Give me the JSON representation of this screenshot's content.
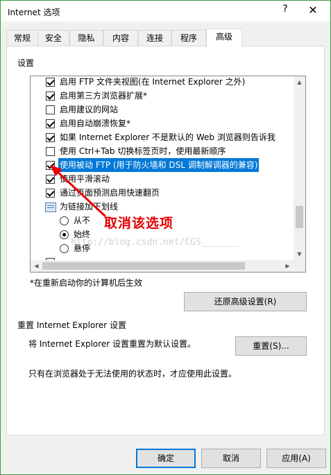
{
  "window": {
    "title": "Internet 选项",
    "help_label": "?",
    "close_label": "✕"
  },
  "tabs": [
    {
      "label": "常规"
    },
    {
      "label": "安全"
    },
    {
      "label": "隐私"
    },
    {
      "label": "内容"
    },
    {
      "label": "连接"
    },
    {
      "label": "程序"
    },
    {
      "label": "高级",
      "active": true
    }
  ],
  "settings": {
    "label": "设置",
    "items": [
      {
        "type": "checkbox",
        "checked": true,
        "label": "启用 FTP 文件夹视图(在 Internet Explorer 之外)"
      },
      {
        "type": "checkbox",
        "checked": true,
        "label": "启用第三方浏览器扩展*"
      },
      {
        "type": "checkbox",
        "checked": false,
        "label": "启用建议的网站"
      },
      {
        "type": "checkbox",
        "checked": true,
        "label": "启用自动崩溃恢复*"
      },
      {
        "type": "checkbox",
        "checked": true,
        "label": "如果 Internet Explorer 不是默认的 Web 浏览器则告诉我"
      },
      {
        "type": "checkbox",
        "checked": false,
        "label": "使用 Ctrl+Tab 切换标签页时，使用最新顺序"
      },
      {
        "type": "checkbox",
        "checked": true,
        "selected": true,
        "label": "使用被动 FTP (用于防火墙和 DSL 调制解调器的兼容)"
      },
      {
        "type": "checkbox",
        "checked": true,
        "label": "使用平滑滚动"
      },
      {
        "type": "checkbox",
        "checked": true,
        "label": "通过页面预测启用快速翻页"
      },
      {
        "type": "group",
        "label": "为链接加下划线"
      },
      {
        "type": "radio",
        "checked": false,
        "label": "从不"
      },
      {
        "type": "radio",
        "checked": true,
        "label": "始终"
      },
      {
        "type": "radio",
        "checked": false,
        "label": "悬停"
      }
    ],
    "restart_note": "*在重新启动你的计算机后生效",
    "restore_button": "还原高级设置(R)"
  },
  "reset": {
    "group_title": "重置 Internet Explorer 设置",
    "description": "将 Internet Explorer 设置重置为默认设置。",
    "button": "重置(S)...",
    "note": "只有在浏览器处于无法使用的状态时，才应使用此设置。"
  },
  "annotation": {
    "text": "取消该选项",
    "color": "#e60000"
  },
  "watermark": "http://blog.csdn.net/CGS_______",
  "footer": {
    "ok": "确定",
    "cancel": "取消",
    "apply": "应用(A)"
  },
  "colors": {
    "accent": "#0078d7",
    "frame": "#3c9a3c",
    "annotation": "#e60000"
  }
}
